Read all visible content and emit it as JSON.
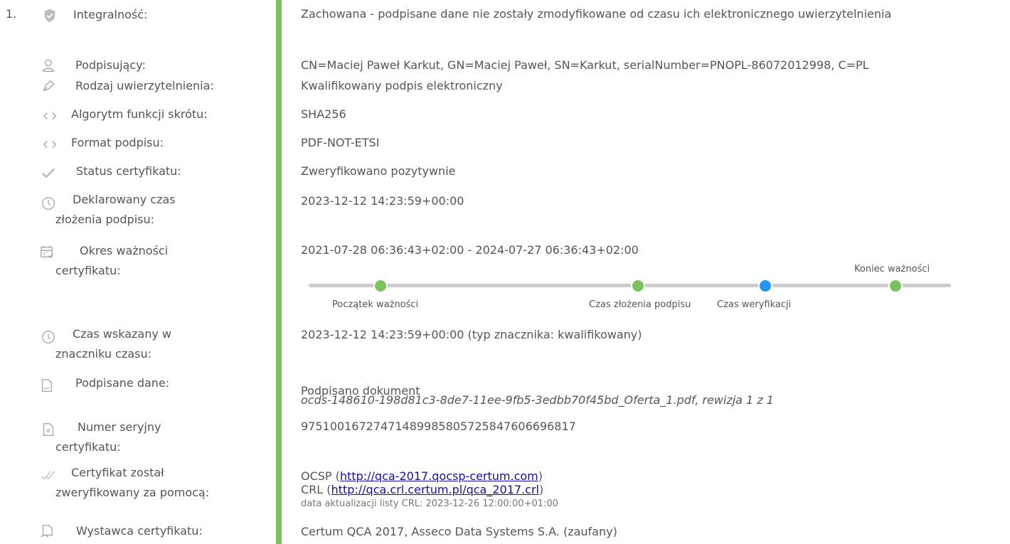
{
  "entry_number": "1.",
  "rows": {
    "integrity": {
      "label": "Integralność:",
      "value": "Zachowana - podpisane dane nie zostały zmodyfikowane od czasu ich elektronicznego uwierzytelnienia"
    },
    "signer": {
      "label": "Podpisujący:",
      "value": "CN=Maciej Paweł Karkut, GN=Maciej Paweł, SN=Karkut, serialNumber=PNOPL-86072012998, C=PL"
    },
    "auth_type": {
      "label": "Rodzaj uwierzytelnienia:",
      "value": "Kwalifikowany podpis elektroniczny"
    },
    "hash_alg": {
      "label": "Algorytm funkcji skrótu:",
      "value": "SHA256"
    },
    "format": {
      "label": "Format podpisu:",
      "value": "PDF-NOT-ETSI"
    },
    "cert_status": {
      "label": "Status certyfikatu:",
      "value": "Zweryfikowano pozytywnie"
    },
    "declared_time": {
      "label_line1": "Deklarowany czas",
      "label_line2": "złożenia podpisu:",
      "value": "2023-12-12 14:23:59+00:00"
    },
    "validity": {
      "label_line1": "Okres ważności",
      "label_line2": "certyfikatu:",
      "value": "2021-07-28 06:36:43+02:00 - 2024-07-27 06:36:43+02:00"
    },
    "timestamp": {
      "label_line1": "Czas wskazany w",
      "label_line2": "znaczniku czasu:",
      "value": "2023-12-12 14:23:59+00:00 (typ znacznika: kwalifikowany)"
    },
    "signed_data": {
      "label": "Podpisane dane:",
      "value_line1": "Podpisano dokument",
      "value_line2": "ocds-148610-198d81c3-8de7-11ee-9fb5-3edbb70f45bd_Oferta_1.pdf, rewizja 1 z 1"
    },
    "serial": {
      "label_line1": "Numer seryjny",
      "label_line2": "certyfikatu:",
      "value": "97510016727471489985805725847606696817"
    },
    "verified_by": {
      "label_line1": "Certyfikat został",
      "label_line2": "zweryfikowany za pomocą:",
      "ocsp_prefix": "OCSP (",
      "ocsp_url": "http://qca-2017.qocsp-certum.com",
      "ocsp_suffix": ")",
      "crl_prefix": "CRL (",
      "crl_url": "http://qca.crl.certum.pl/qca_2017.crl",
      "crl_suffix": ")",
      "crl_update": "data aktualizacji listy CRL: 2023-12-26 12:00:00+01:00"
    },
    "issuer": {
      "label": "Wystawca certyfikatu:",
      "value": "Certum QCA 2017, Asseco Data Systems S.A. (zaufany)"
    }
  },
  "timeline": {
    "start_label": "Początek ważności",
    "signing_label": "Czas złożenia podpisu",
    "verification_label": "Czas weryfikacji",
    "end_label": "Koniec ważności",
    "colors": {
      "track": "#cccccc",
      "green": "#7ac35c",
      "blue": "#2196f3"
    }
  },
  "colors": {
    "accent_bar": "#7ac35c",
    "text": "#555555",
    "link": "#1a0dab"
  }
}
